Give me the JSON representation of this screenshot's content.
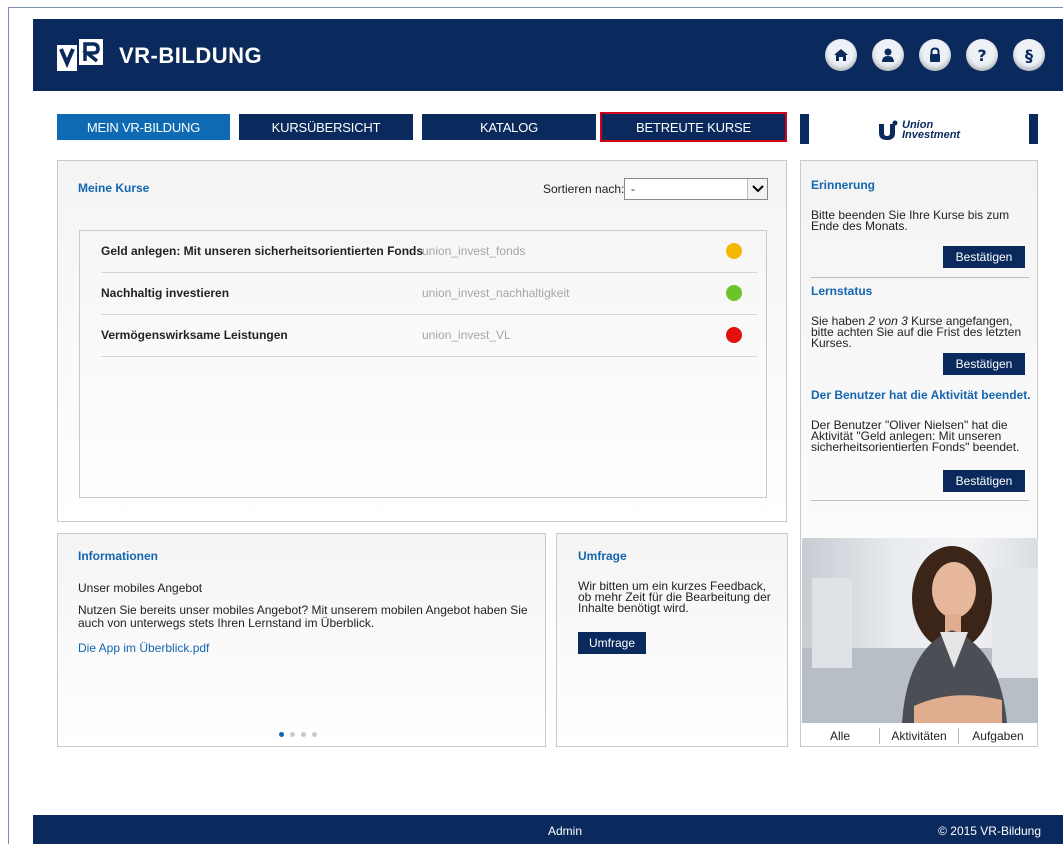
{
  "header": {
    "logo_text": "VR-BILDUNG",
    "icons": [
      "home-icon",
      "user-icon",
      "lock-icon",
      "help-icon",
      "paragraph-icon"
    ],
    "help_glyph": "?",
    "paragraph_glyph": "§"
  },
  "nav": {
    "tabs": [
      {
        "label": "MEIN VR-BILDUNG",
        "state": "active"
      },
      {
        "label": "KURSÜBERSICHT",
        "state": "normal"
      },
      {
        "label": "KATALOG",
        "state": "normal"
      },
      {
        "label": "BETREUTE KURSE",
        "state": "focused"
      }
    ],
    "partner_logo": {
      "line1": "Union",
      "line2": "Investment"
    }
  },
  "courses": {
    "title": "Meine Kurse",
    "sort_label": "Sortieren nach:",
    "sort_value": "-",
    "items": [
      {
        "name": "Geld anlegen: Mit unseren sicherheitsorientierten Fonds",
        "code": "union_invest_fonds",
        "status_color": "#f5b800"
      },
      {
        "name": "Nachhaltig investieren",
        "code": "union_invest_nachhaltigkeit",
        "status_color": "#6cc42a"
      },
      {
        "name": "Vermögenswirksame Leistungen",
        "code": "union_invest_VL",
        "status_color": "#e2100e"
      }
    ]
  },
  "info": {
    "title": "Informationen",
    "subtitle": "Unser mobiles Angebot",
    "body": "Nutzen Sie bereits unser mobiles Angebot? Mit unserem mobilen Angebot haben Sie auch von unterwegs stets Ihren Lernstand im Überblick.",
    "link": "Die App im Überblick.pdf",
    "carousel": {
      "slides": 4,
      "active": 1
    }
  },
  "survey": {
    "title": "Umfrage",
    "body": "Wir bitten um ein kurzes Feedback, ob mehr Zeit für die Bearbeitung der Inhalte benötigt wird.",
    "button": "Umfrage"
  },
  "sidebar": {
    "sections": [
      {
        "title": "Erinnerung",
        "text": "Bitte beenden Sie Ihre Kurse bis zum Ende des Monats.",
        "button": "Bestätigen"
      },
      {
        "title": "Lernstatus",
        "text_before": "Sie haben ",
        "text_em": "2 von 3",
        "text_after": " Kurse angefangen, bitte achten Sie auf die Frist des letzten Kurses.",
        "button": "Bestätigen"
      },
      {
        "title": "Der Benutzer hat die Aktivität beendet.",
        "text": "Der Benutzer \"Oliver Nielsen\" hat die Aktivität \"Geld anlegen: Mit unseren sicherheitsorientierten Fonds\" beendet.",
        "button": "Bestätigen"
      }
    ],
    "filters": [
      "Alle",
      "Aktivitäten",
      "Aufgaben"
    ]
  },
  "footer": {
    "center": "Admin",
    "right": "© 2015 VR-Bildung"
  },
  "colors": {
    "brand_navy": "#0a2a5e",
    "active_tab": "#0e6bb3",
    "link_blue": "#1566b0",
    "focus_red": "#d0021b"
  }
}
